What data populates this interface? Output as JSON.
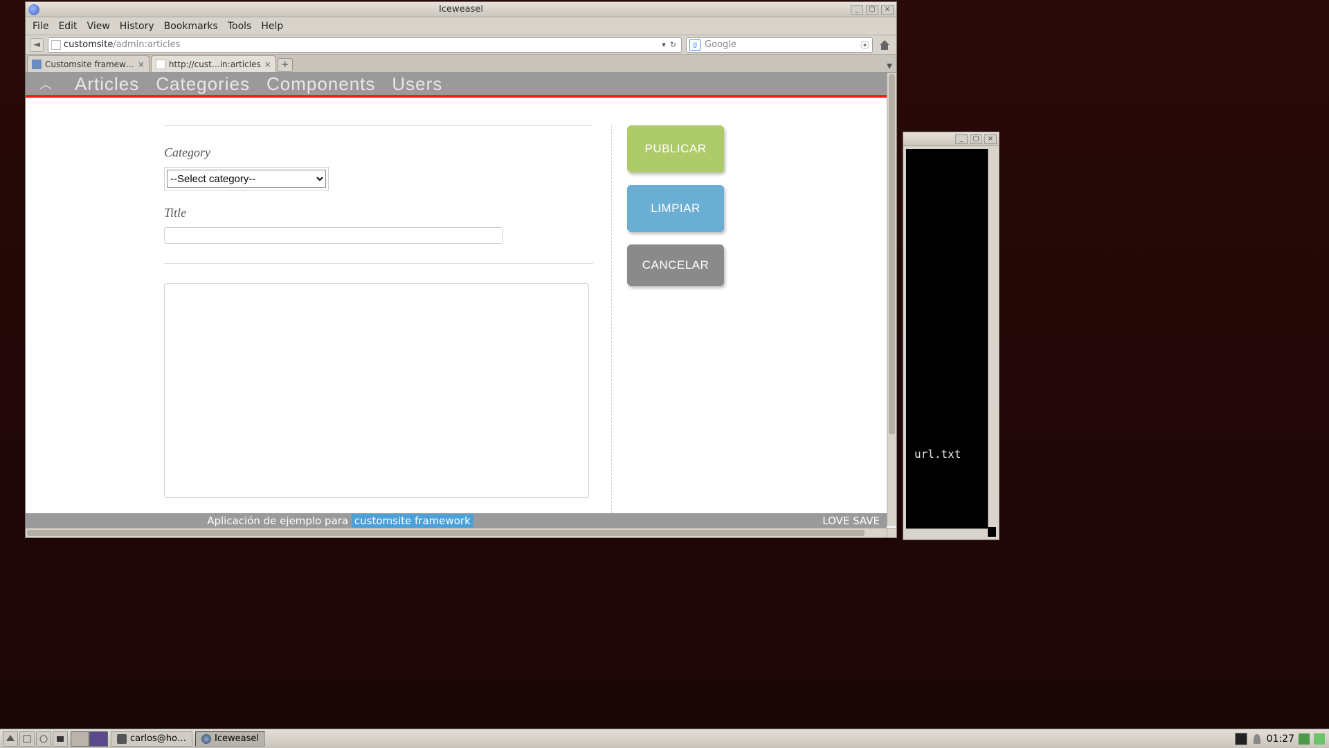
{
  "window": {
    "title": "Iceweasel",
    "buttons": {
      "min": "_",
      "max": "▢",
      "close": "×"
    }
  },
  "menubar": [
    "File",
    "Edit",
    "View",
    "History",
    "Bookmarks",
    "Tools",
    "Help"
  ],
  "urlbar": {
    "host": "customsite",
    "path": "/admin:articles"
  },
  "searchbar": {
    "engine_letter": "g",
    "placeholder": "Google"
  },
  "tabs": [
    {
      "label": "Customsite framew…",
      "active": false,
      "favicon": "colored"
    },
    {
      "label": "http://cust…in:articles",
      "active": true,
      "favicon": "blank"
    }
  ],
  "admin_nav": {
    "chevron": "︿",
    "items": [
      "Articles",
      "Categories",
      "Components",
      "Users"
    ]
  },
  "form": {
    "category_label": "Category",
    "category_selected": "--Select category--",
    "title_label": "Title",
    "title_value": ""
  },
  "actions": {
    "publish": "PUBLICAR",
    "clear": "LIMPIAR",
    "cancel": "CANCELAR"
  },
  "footer": {
    "prefix": "Aplicación de ejemplo para ",
    "link": "customsite framework",
    "right": "LOVE SAVE"
  },
  "second_window": {
    "file": "url.txt"
  },
  "taskbar": {
    "items": [
      {
        "label": "carlos@ho…",
        "icon": "term",
        "active": false
      },
      {
        "label": "Iceweasel",
        "icon": "globe",
        "active": true
      }
    ],
    "clock": "01:27"
  }
}
